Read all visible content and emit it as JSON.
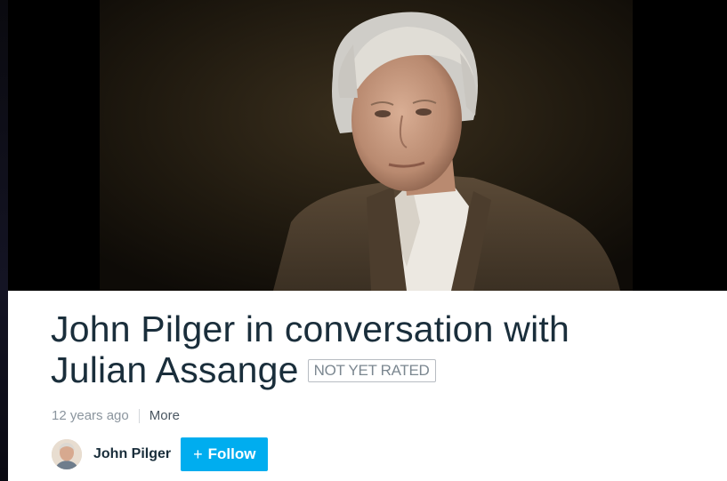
{
  "video": {
    "thumbnail_icon": "video-thumbnail-portrait"
  },
  "clip": {
    "title_line1": "John Pilger in conversation with",
    "title_line2": "Julian Assange",
    "rating": "NOT YET RATED",
    "age": "12 years ago",
    "more_label": "More"
  },
  "owner": {
    "name": "John Pilger",
    "follow_label": "Follow",
    "follow_plus": "+"
  },
  "colors": {
    "accent": "#00adef",
    "title": "#1a2e3b",
    "muted": "#8b959e"
  }
}
